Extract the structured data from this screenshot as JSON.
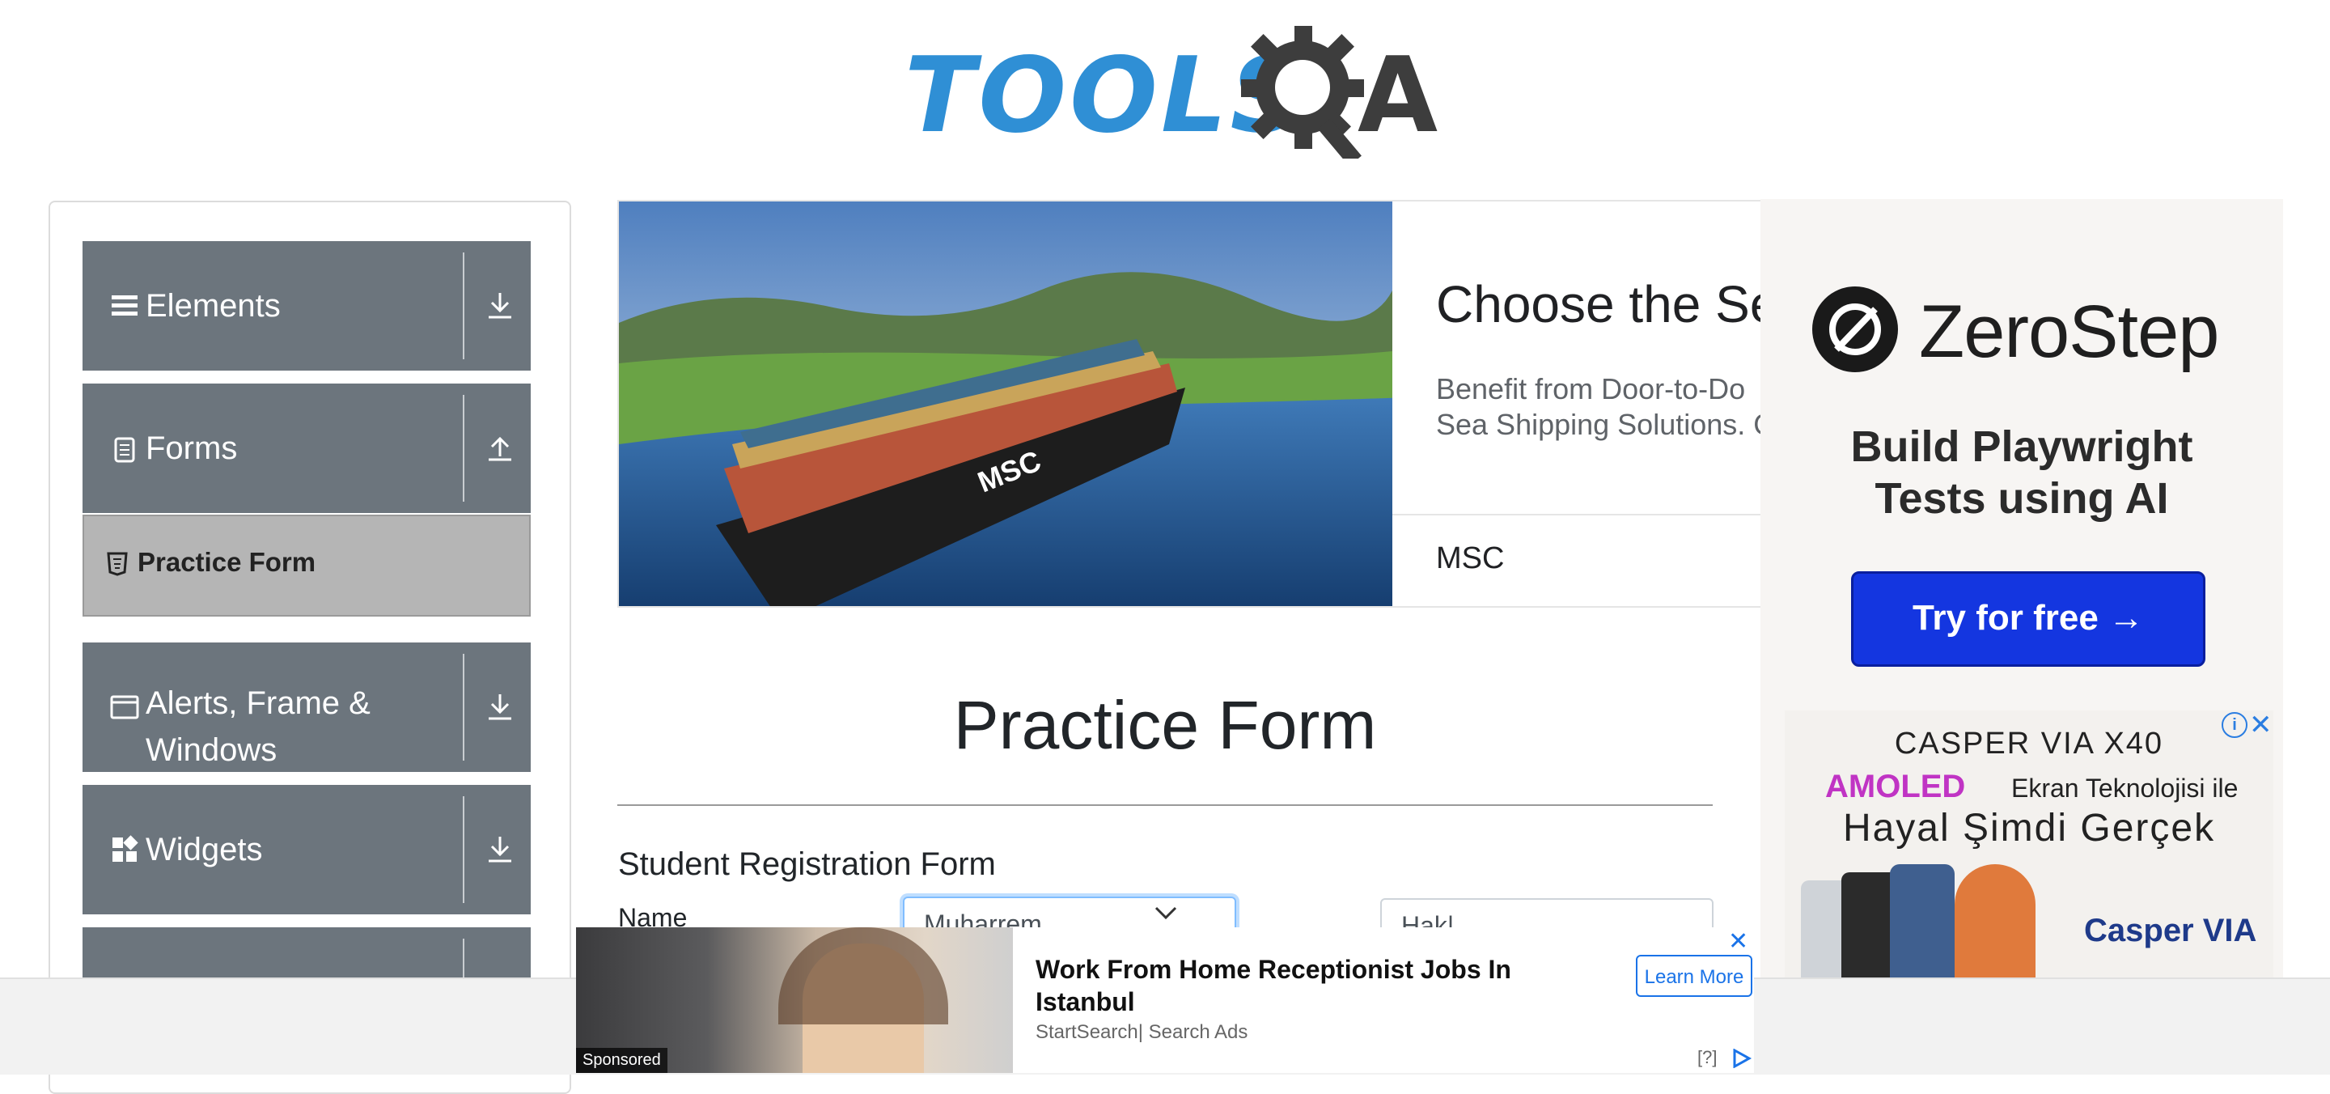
{
  "logo": {
    "text": "TOOLS",
    "a": "A"
  },
  "sidebar": {
    "groups": [
      {
        "label": "Elements",
        "arrow": "download"
      },
      {
        "label": "Forms",
        "arrow": "upload"
      },
      {
        "label": "Alerts, Frame & Windows",
        "arrow": "download"
      },
      {
        "label": "Widgets",
        "arrow": "download"
      }
    ],
    "active_item": "Practice Form"
  },
  "banner": {
    "title": "Choose the Sea",
    "description": "Benefit from Door-to-Do Sea Shipping Solutions. G",
    "brand": "MSC",
    "ship_text": "MSC"
  },
  "right_ad": {
    "brand": "ZeroStep",
    "tagline": "Build Playwright Tests using AI",
    "button": "Try for free →",
    "casper_line1": "CASPER VIA X40",
    "casper_amoled": "AMOLED",
    "casper_line2": "Ekran Teknolojisi ile",
    "casper_line3": "Hayal Şimdi Gerçek",
    "casper_brand": "Casper VIA"
  },
  "form": {
    "title": "Practice Form",
    "heading": "Student Registration Form",
    "name_label": "Name",
    "first_name_value": "Muharrem",
    "last_name_value": "Hak|"
  },
  "sponsored": {
    "tag": "Sponsored",
    "title": "Work From Home Receptionist Jobs In Istanbul",
    "source": "StartSearch| Search Ads",
    "button": "Learn More",
    "help": "[?]"
  }
}
